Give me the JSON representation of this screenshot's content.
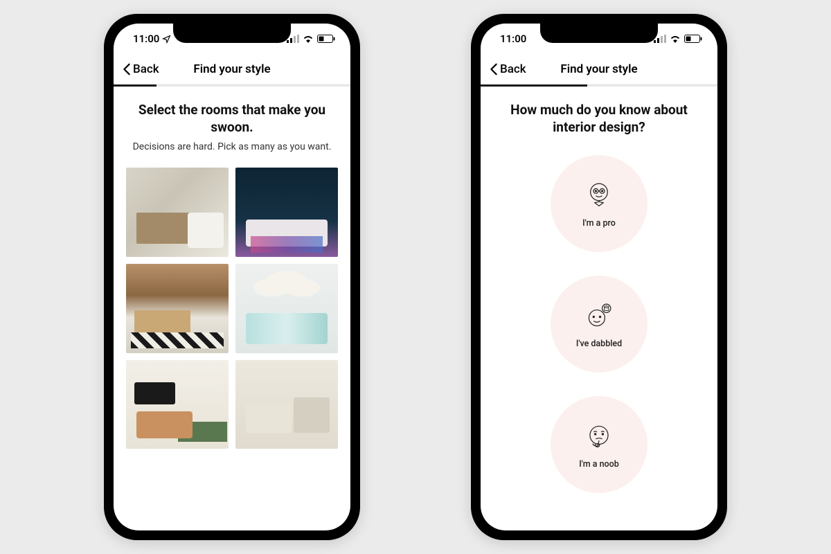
{
  "colors": {
    "background": "#ebebeb",
    "phone_frame": "#000000",
    "option_bg": "#fbf0ed",
    "progress_fill": "#1a1a1a"
  },
  "status": {
    "time": "11:00"
  },
  "nav": {
    "back_label": "Back",
    "title": "Find your style"
  },
  "screen1": {
    "progress_percent": 18,
    "heading": "Select the rooms that make you swoon.",
    "subheading": "Decisions are hard. Pick as many as you want.",
    "room_tiles": 6
  },
  "screen2": {
    "progress_percent": 45,
    "heading": "How much do you know about interior design?",
    "options": [
      {
        "label": "I'm a pro",
        "icon": "pro-face-icon"
      },
      {
        "label": "I've dabbled",
        "icon": "dabbled-face-icon"
      },
      {
        "label": "I'm a noob",
        "icon": "noob-face-icon"
      }
    ]
  }
}
